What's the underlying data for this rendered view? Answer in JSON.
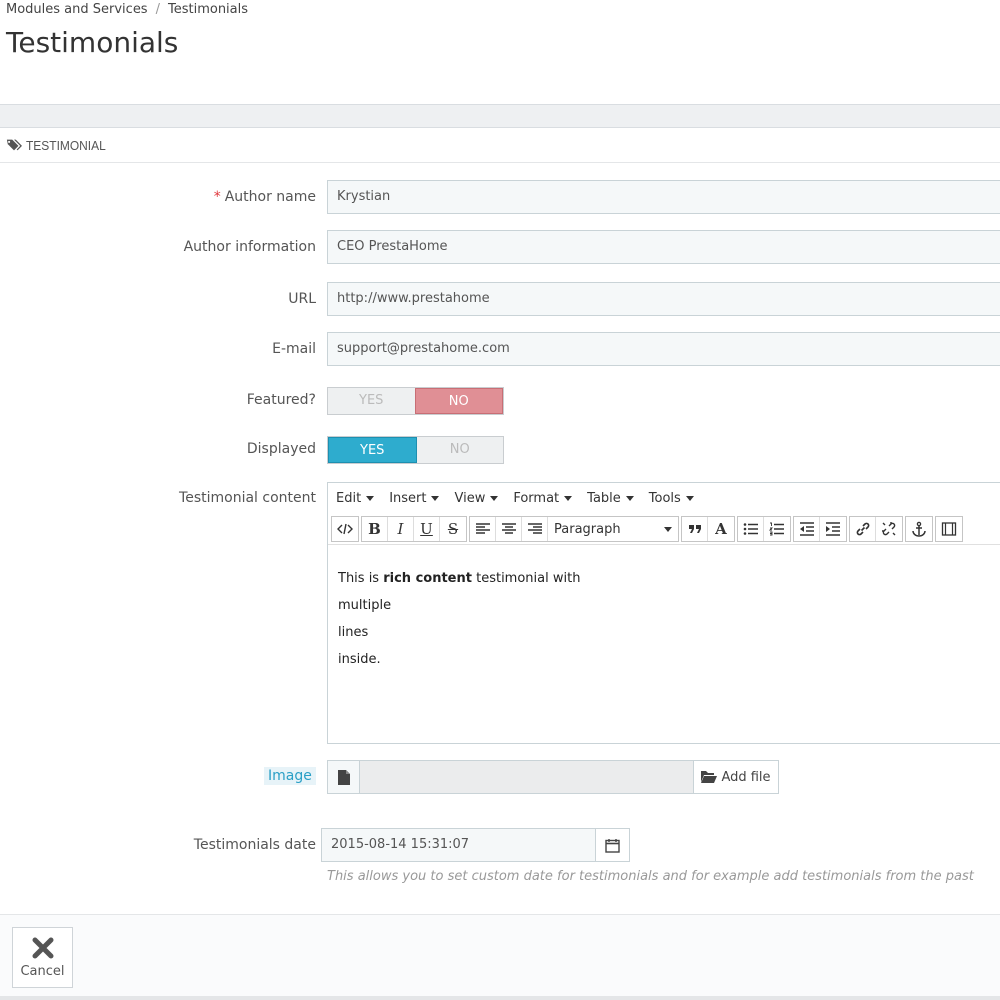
{
  "breadcrumb": {
    "parent": "Modules and Services",
    "separator": "/",
    "current": "Testimonials"
  },
  "page_title": "Testimonials",
  "panel": {
    "title": "TESTIMONIAL",
    "icon": "tags-icon"
  },
  "fields": {
    "author_name": {
      "label": "Author name",
      "required_mark": "*",
      "value": "Krystian"
    },
    "author_info": {
      "label": "Author information",
      "value": "CEO PrestaHome"
    },
    "url": {
      "label": "URL",
      "value": "http://www.prestahome"
    },
    "email": {
      "label": "E-mail",
      "value": "support@prestahome.com"
    },
    "featured": {
      "label": "Featured?",
      "yes": "YES",
      "no": "NO",
      "selected": "NO"
    },
    "displayed": {
      "label": "Displayed",
      "yes": "YES",
      "no": "NO",
      "selected": "YES"
    },
    "content": {
      "label": "Testimonial content",
      "menu": [
        "Edit",
        "Insert",
        "View",
        "Format",
        "Table",
        "Tools"
      ],
      "format_select": "Paragraph",
      "body": {
        "line1_pre": "This is ",
        "line1_bold": "rich content",
        "line1_post": " testimonial with",
        "line2": "multiple",
        "line3": "lines",
        "line4": "inside."
      }
    },
    "image": {
      "label": "Image",
      "add_file": "Add file"
    },
    "date": {
      "label": "Testimonials date",
      "value": "2015-08-14 15:31:07",
      "help": "This allows you to set custom date for testimonials and for example add testimonials from the past"
    }
  },
  "footer": {
    "cancel": "Cancel"
  },
  "colors": {
    "no_active": "#e08f95",
    "yes_active": "#2eacce",
    "required": "#e0363b",
    "link": "#2a9fc6"
  }
}
